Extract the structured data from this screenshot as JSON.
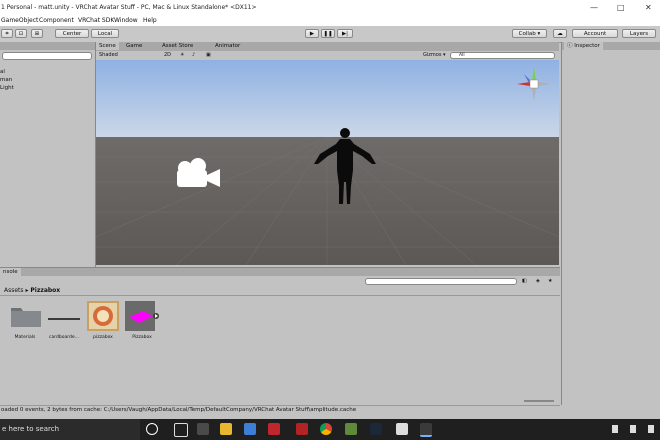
{
  "window": {
    "title": "1 Personal - matt.unity - VRChat Avatar Stuff - PC, Mac & Linux Standalone* <DX11>",
    "minimize": "—",
    "maximize": "□",
    "close": "✕"
  },
  "menu": [
    "GameObject",
    "Component",
    "VRChat SDK",
    "Window",
    "Help"
  ],
  "toolbar": {
    "center": "Center",
    "local": "Local",
    "collab": "Collab ▾",
    "account": "Account",
    "layers": "Layers"
  },
  "hierarchy": {
    "items": [
      "al",
      "man",
      "Light"
    ]
  },
  "scene_tabs": [
    "Scene",
    "Game",
    "Asset Store",
    "Animator"
  ],
  "scene_toolbar": {
    "shading": "Shaded",
    "mode_2d": "2D",
    "gizmos": "Gizmos ▾",
    "search_placeholder": "All"
  },
  "inspector": {
    "tab": "Inspector"
  },
  "project": {
    "tab": "nsole",
    "breadcrumb_root": "Assets",
    "breadcrumb_current": "Pizzabox",
    "assets": [
      {
        "label": "Materials",
        "icon": "folder-icon"
      },
      {
        "label": "cardboarde...",
        "icon": "mesh-icon"
      },
      {
        "label": "pizzabox",
        "icon": "texture-icon"
      },
      {
        "label": "Pizzabox",
        "icon": "prefab-icon"
      }
    ]
  },
  "status": {
    "message": "oaded 0 events, 2 bytes from cache: C:/Users/Vaugh/AppData/Local/Temp/DefaultCompany/VRChat Avatar Stuff\\amplitude.cache"
  },
  "taskbar": {
    "search": "e here to search"
  },
  "colors": {
    "sky": "#a8c0e6",
    "ground": "#656260",
    "prefab_magenta": "#ff00ff",
    "taskbar": "#1f1f1f"
  }
}
